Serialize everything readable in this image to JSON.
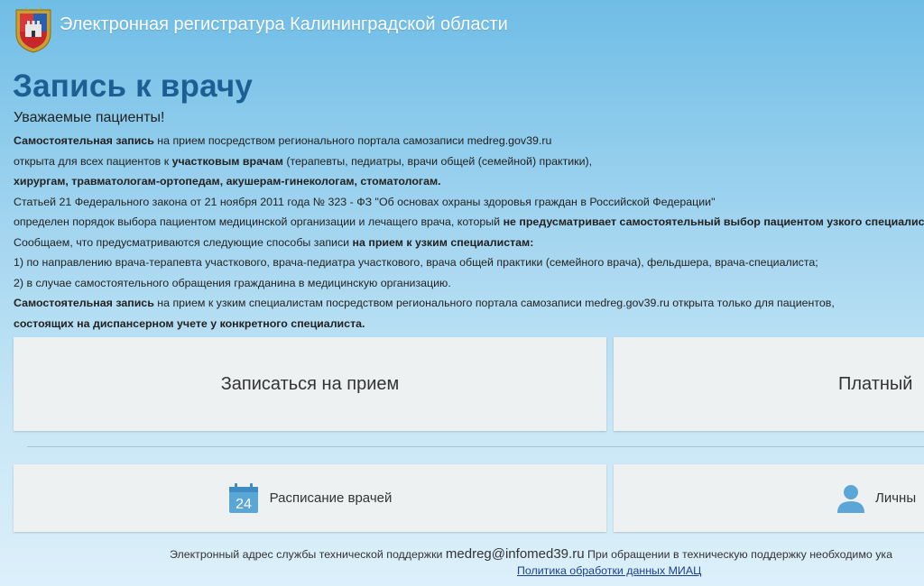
{
  "header": {
    "site_title": "Электронная регистратура Калининградской области",
    "coat_icon": "coat-of-arms-icon"
  },
  "main": {
    "page_title": "Запись к врачу",
    "subtitle": "Уважаемые пациенты!",
    "notice": {
      "l1_bold": "Самостоятельная запись",
      "l1_text": " на прием посредством регионального портала самозаписи medreg.gov39.ru",
      "l2_text": "открыта для всех пациентов к ",
      "l2_bold": "участковым врачам",
      "l2_text2": " (терапевты, педиатры, врачи общей (семейной) практики),",
      "l3_bold": "хирургам, травматологам-ортопедам, акушерам-гинекологам, стоматологам.",
      "l4_text": "Статьей 21 Федерального закона от 21 ноября 2011 года № 323 - ФЗ \"Об основах охраны здоровья граждан в Российской Федерации\"",
      "l5_text": "определен порядок выбора пациентом медицинской организации и лечащего врача, который ",
      "l5_bold": "не предусматривает самостоятельный выбор пациентом узкого специалиста",
      "l6_text": "Сообщаем, что предусматриваются следующие способы записи ",
      "l6_bold": "на прием к узким специалистам:",
      "l7_text": "1) по направлению врача-терапевта участкового, врача-педиатра участкового, врача общей практики (семейного врача), фельдшера, врача-специалиста;",
      "l8_text": "2) в случае самостоятельного обращения гражданина в медицинскую организацию.",
      "l9_bold": "Самостоятельная запись",
      "l9_text": " на прием к узким специалистам посредством регионального портала самозаписи medreg.gov39.ru открыта только для пациентов,",
      "l10_bold": "состоящих на диспансерном учете у конкретного специалиста."
    }
  },
  "tiles": {
    "appointment_label": "Записаться на прием",
    "paid_label": "Платный",
    "schedule_label": "Расписание врачей",
    "schedule_icon": "calendar-icon",
    "calendar_day": "24",
    "personal_label": "Личны",
    "personal_icon": "user-icon"
  },
  "footer": {
    "support_text": "Электронный адрес службы технической поддержки ",
    "support_email": "medreg@infomed39.ru",
    "support_text2": " При обращении в техническую поддержку необходимо ука",
    "policy_link": "Политика обработки данных МИАЦ"
  },
  "colors": {
    "title_blue": "#1d5f93",
    "tile_bg": "#eef1f2",
    "link": "#1a3f8f",
    "icon_blue": "#5aa6d6"
  }
}
